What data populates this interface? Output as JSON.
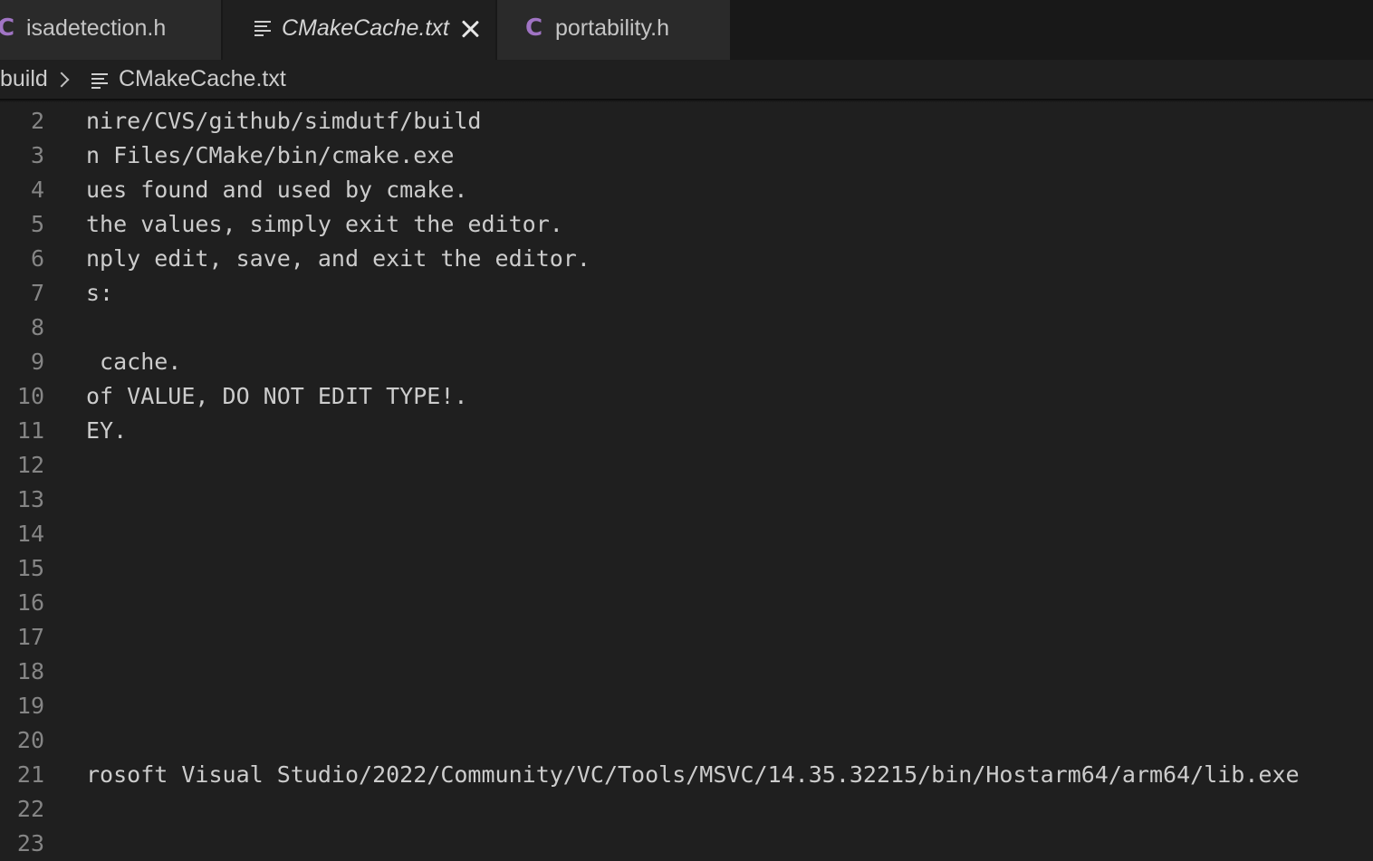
{
  "tabs": [
    {
      "label": "isadetection.h",
      "icon": "c-file-icon",
      "active": false
    },
    {
      "label": "CMakeCache.txt",
      "icon": "text-lines-icon",
      "active": true
    },
    {
      "label": "portability.h",
      "icon": "c-file-icon",
      "active": false
    }
  ],
  "c_icon_glyph": "C",
  "breadcrumb": {
    "folder": "build",
    "file": "CMakeCache.txt"
  },
  "colors": {
    "background": "#1f1f1f",
    "tabbar": "#181818",
    "c_icon": "#a074c4",
    "line_number": "#858585",
    "text": "#cccccc"
  },
  "editor": {
    "lines": [
      {
        "num": "2",
        "text": "nire/CVS/github/simdutf/build"
      },
      {
        "num": "3",
        "text": "n Files/CMake/bin/cmake.exe"
      },
      {
        "num": "4",
        "text": "ues found and used by cmake."
      },
      {
        "num": "5",
        "text": "the values, simply exit the editor."
      },
      {
        "num": "6",
        "text": "nply edit, save, and exit the editor."
      },
      {
        "num": "7",
        "text": "s:"
      },
      {
        "num": "8",
        "text": ""
      },
      {
        "num": "9",
        "text": " cache."
      },
      {
        "num": "10",
        "text": "of VALUE, DO NOT EDIT TYPE!."
      },
      {
        "num": "11",
        "text": "EY."
      },
      {
        "num": "12",
        "text": ""
      },
      {
        "num": "13",
        "text": ""
      },
      {
        "num": "14",
        "text": ""
      },
      {
        "num": "15",
        "text": ""
      },
      {
        "num": "16",
        "text": ""
      },
      {
        "num": "17",
        "text": ""
      },
      {
        "num": "18",
        "text": ""
      },
      {
        "num": "19",
        "text": ""
      },
      {
        "num": "20",
        "text": ""
      },
      {
        "num": "21",
        "text": "rosoft Visual Studio/2022/Community/VC/Tools/MSVC/14.35.32215/bin/Hostarm64/arm64/lib.exe"
      },
      {
        "num": "22",
        "text": ""
      },
      {
        "num": "23",
        "text": ""
      }
    ]
  }
}
